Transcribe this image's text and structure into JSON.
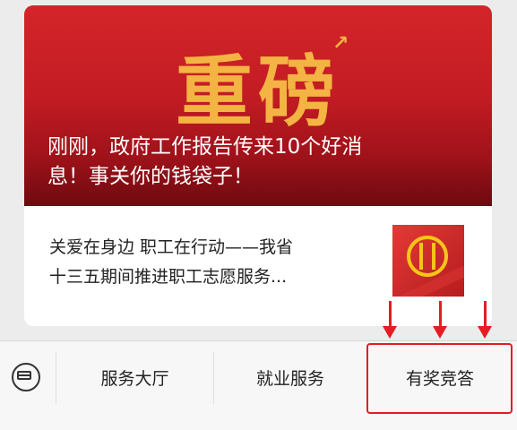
{
  "banner": {
    "big_title": "重磅",
    "headline_line1": "刚刚，政府工作报告传来10个好消",
    "headline_line2": "息！事关你的钱袋子！"
  },
  "article": {
    "title_line1": "关爱在身边 职工在行动——我省",
    "title_line2": "十三五期间推进职工志愿服务..."
  },
  "menu": {
    "items": [
      {
        "label": "服务大厅"
      },
      {
        "label": "就业服务"
      },
      {
        "label": "有奖竞答"
      }
    ]
  },
  "colors": {
    "highlight": "#e51c23",
    "banner_red": "#c31c23",
    "title_gold": "#f4b443"
  },
  "icons": {
    "keyboard": "keyboard-icon",
    "thumbnail_logo": "union-emblem-icon"
  }
}
